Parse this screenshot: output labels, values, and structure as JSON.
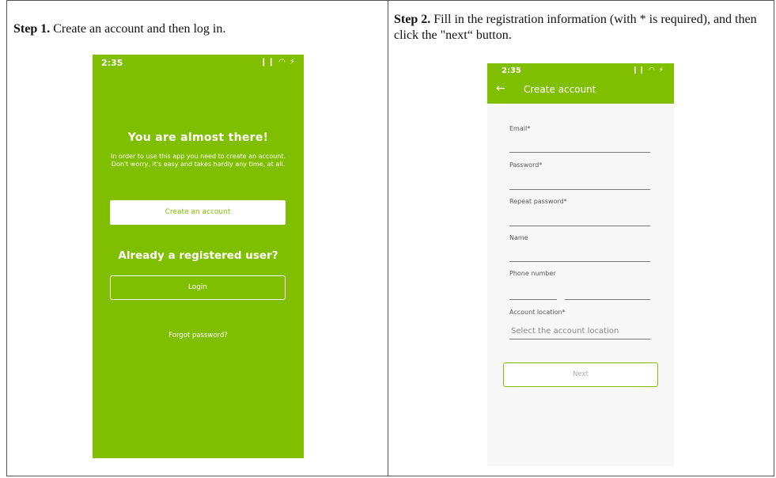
{
  "step1": {
    "label": "Step 1.",
    "text": " Create an account and then log in."
  },
  "step2": {
    "label": "Step 2.",
    "text": " Fill in the registration information (with * is required), and then click the \"next“ button."
  },
  "phone1": {
    "time": "2:35",
    "status_icons": "❙❙ ◠ ⚡",
    "title": "You are almost there!",
    "message": "In order to use this app you need to create an account. Don't worry, it's easy and takes hardly any time, at all.",
    "create_button": "Create an account",
    "registered_title": "Already a registered user?",
    "login_button": "Login",
    "forgot_link": "Forgot password?",
    "bg_color": "#7fbf00"
  },
  "phone2": {
    "time": "2:35",
    "status_icons": "❙❙ ◠ ⚡",
    "back_icon": "←",
    "title": "Create account",
    "fields": {
      "email": "Email*",
      "password": "Password*",
      "repeat_password": "Repeat password*",
      "name": "Name",
      "phone": "Phone number",
      "location": "Account location*",
      "location_placeholder": "Select the account location"
    },
    "next_button": "Next",
    "accent_color": "#7fbf00"
  }
}
